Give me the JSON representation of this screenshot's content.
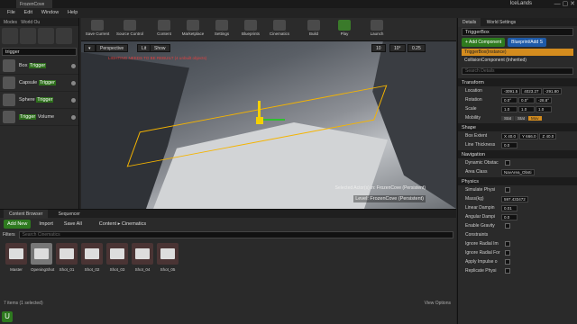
{
  "window": {
    "tab": "FrozenCove",
    "level": "IceLands"
  },
  "menu": [
    "File",
    "Edit",
    "Window",
    "Help"
  ],
  "modes": {
    "title": "Modes",
    "world_outliner": "World Ou",
    "search": "trigger",
    "items": [
      {
        "pre": "Box ",
        "hl": "Trigger",
        "post": ""
      },
      {
        "pre": "Capsule ",
        "hl": "Trigger",
        "post": ""
      },
      {
        "pre": "Sphere ",
        "hl": "Trigger",
        "post": ""
      },
      {
        "pre": "",
        "hl": "Trigger",
        "post": " Volume"
      }
    ]
  },
  "toolbar": [
    "Save Current",
    "Source Control",
    "Content",
    "Marketplace",
    "Settings",
    "Blueprints",
    "Cinematics",
    "Build",
    "Play",
    "Launch"
  ],
  "viewport": {
    "perspective": "Perspective",
    "lit": "Lit",
    "show": "Show",
    "warning": "LIGHTING NEEDS TO BE REBUILT (4 unbuilt objects)",
    "selected": "Selected Actor(s) in: FrozenCove (Persistent)",
    "level": "Level: FrozenCove (Persistent)",
    "snap": [
      "10",
      "10°",
      "0.25"
    ]
  },
  "content_browser": {
    "tabs": [
      "Content Browser",
      "Sequencer"
    ],
    "add_new": "Add New",
    "import": "Import",
    "save_all": "Save All",
    "path": [
      "Content",
      "Cinematics"
    ],
    "filters": "Filters",
    "search_placeholder": "Search Cinematics",
    "assets": [
      "Master",
      "OpeningShot",
      "Shot_01",
      "Shot_02",
      "Shot_03",
      "Shot_04",
      "Shot_05"
    ],
    "status": "7 items (1 selected)",
    "view_options": "View Options"
  },
  "details": {
    "tabs": [
      "Details",
      "World Settings"
    ],
    "actor": "TriggerBox",
    "add_component": "+ Add Component",
    "blueprint": "Blueprint/Add S",
    "components": [
      "TriggerBox(Instance)",
      "CollisionComponent (Inherited)"
    ],
    "search": "Search Details",
    "transform": "Transform",
    "location_label": "Location",
    "location": [
      "-3091.5",
      "4023.27",
      "-291.80"
    ],
    "rotation_label": "Rotation",
    "rotation": [
      "0.0°",
      "0.0°",
      "-28.8°"
    ],
    "scale_label": "Scale",
    "scale": [
      "1.0",
      "1.0",
      "1.0"
    ],
    "mobility_label": "Mobility",
    "mobility": [
      "Stat",
      "Stat",
      "Mov"
    ],
    "shape": "Shape",
    "box_extent_label": "Box Extent",
    "box_extent": [
      "X 40.0",
      "Y 666.0",
      "Z 40.0"
    ],
    "line_thickness_label": "Line Thickness",
    "line_thickness": "0.0",
    "navigation": "Navigation",
    "dynamic_obstacle": "Dynamic Obstac",
    "area_class_label": "Area Class",
    "area_class": "NavArea_Obsti",
    "physics": "Physics",
    "simulate_physics": "Simulate Physi",
    "mass_label": "Mass(kg)",
    "mass": "597.433472",
    "linear_damping_label": "Linear Dampin",
    "linear_damping": "0.01",
    "angular_damping_label": "Angular Dampi",
    "angular_damping": "0.0",
    "enable_gravity": "Enable Gravity",
    "constraints": "Constraints",
    "ignore_radial_impulse": "Ignore Radial Im",
    "ignore_radial_force": "Ignore Radial For",
    "apply_impulse": "Apply Impulse o",
    "replicate_physics": "Replicate Physi"
  }
}
